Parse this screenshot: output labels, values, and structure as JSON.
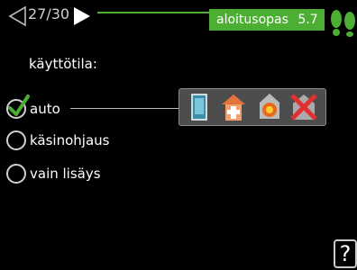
{
  "header": {
    "page_counter": "27/30",
    "guide_title": "aloitusopas",
    "guide_number": "5.7",
    "accent_color": "#4cae32"
  },
  "section": {
    "label": "käyttötila:"
  },
  "options": [
    {
      "label": "auto",
      "selected": true
    },
    {
      "label": "käsinohjaus",
      "selected": false
    },
    {
      "label": "vain lisäys",
      "selected": false
    }
  ],
  "mode_icons": [
    "water-heater-icon",
    "heat-pump-icon",
    "additional-heat-icon",
    "disabled-heating-icon"
  ],
  "help": {
    "label": "?"
  }
}
